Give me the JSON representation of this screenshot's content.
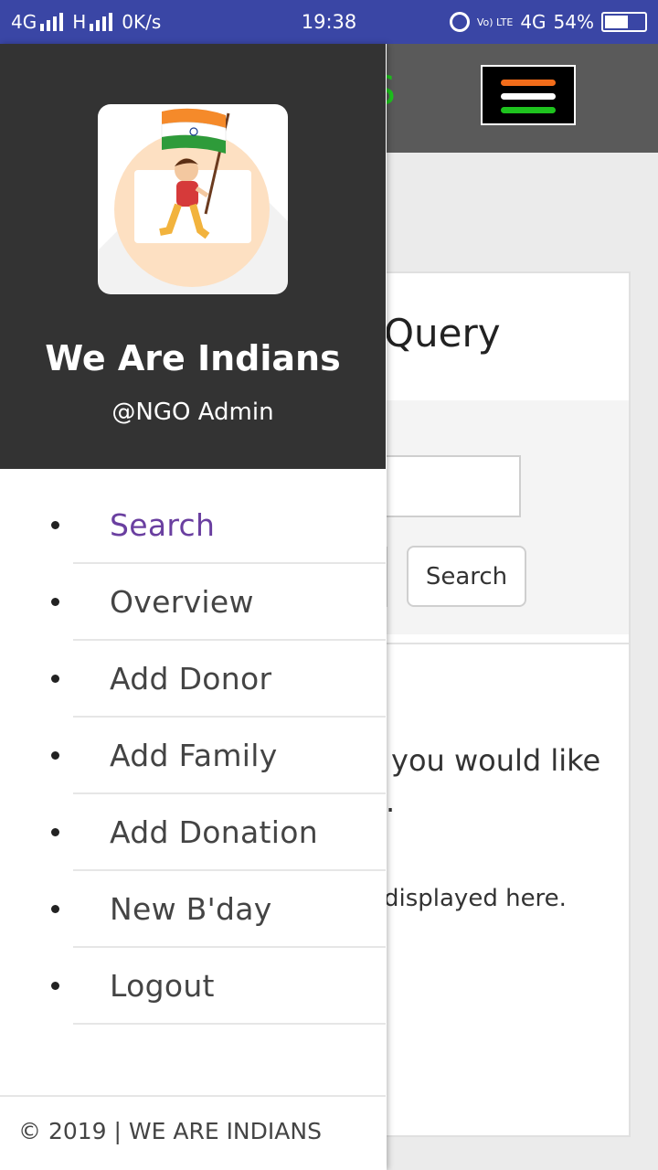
{
  "status_bar": {
    "network1": "4G",
    "network2": "H",
    "speed": "0K/s",
    "time": "19:38",
    "volte": "Vo) LTE",
    "network3": "4G",
    "battery": "54%"
  },
  "appbar": {
    "logo_partial": "S",
    "hamburger_colors": [
      "#f26c1a",
      "#ffffff",
      "#1ec31e"
    ]
  },
  "background_page": {
    "card_title": "Query",
    "search_button": "Search",
    "text_line1": "you would like",
    "text_line1b": ".",
    "text_line2": "displayed here."
  },
  "drawer": {
    "app_name": "We Are Indians",
    "user_handle": "@NGO Admin",
    "menu": [
      {
        "label": "Search",
        "active": true
      },
      {
        "label": "Overview",
        "active": false
      },
      {
        "label": "Add Donor",
        "active": false
      },
      {
        "label": "Add Family",
        "active": false
      },
      {
        "label": "Add Donation",
        "active": false
      },
      {
        "label": "New B'day",
        "active": false
      },
      {
        "label": "Logout",
        "active": false
      }
    ],
    "footer": "© 2019 | WE ARE INDIANS"
  },
  "colors": {
    "status_bar": "#3a46a5",
    "drawer_header": "#333333",
    "active_link": "#6a3fa0"
  }
}
